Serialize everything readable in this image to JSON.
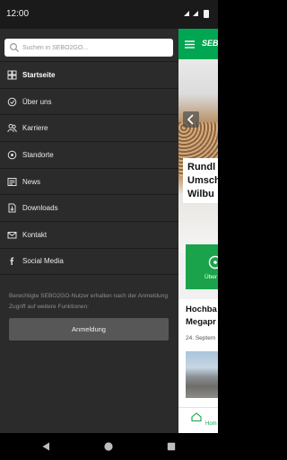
{
  "status_bar": {
    "time": "12:00"
  },
  "search": {
    "placeholder": "Suchen in SEBO2GO..."
  },
  "menu": {
    "items": [
      {
        "label": "Startseite",
        "icon": "home-icon",
        "active": true
      },
      {
        "label": "Über uns",
        "icon": "info-icon"
      },
      {
        "label": "Karriere",
        "icon": "people-icon"
      },
      {
        "label": "Standorte",
        "icon": "location-icon"
      },
      {
        "label": "News",
        "icon": "newspaper-icon"
      },
      {
        "label": "Downloads",
        "icon": "download-icon"
      },
      {
        "label": "Kontakt",
        "icon": "mail-icon"
      },
      {
        "label": "Social Media",
        "icon": "facebook-icon"
      }
    ]
  },
  "login": {
    "info": "Berechtigte SEBO2GO-Nutzer erhalten nach der Anmeldung Zugriff auf weitere Funktionen:",
    "button_label": "Anmeldung"
  },
  "background_page": {
    "logo_text": "SEB",
    "hero_title": "Rundl\nUmsch\nWilbu",
    "tile_label": "Über",
    "news_title": "Hochba\nMegapr",
    "news_date": "24. Septem",
    "bottom_tab_label": "Hom"
  },
  "colors": {
    "brand_green": "#00a651",
    "drawer_bg": "#2b2b2b",
    "button_grey": "#575757"
  }
}
